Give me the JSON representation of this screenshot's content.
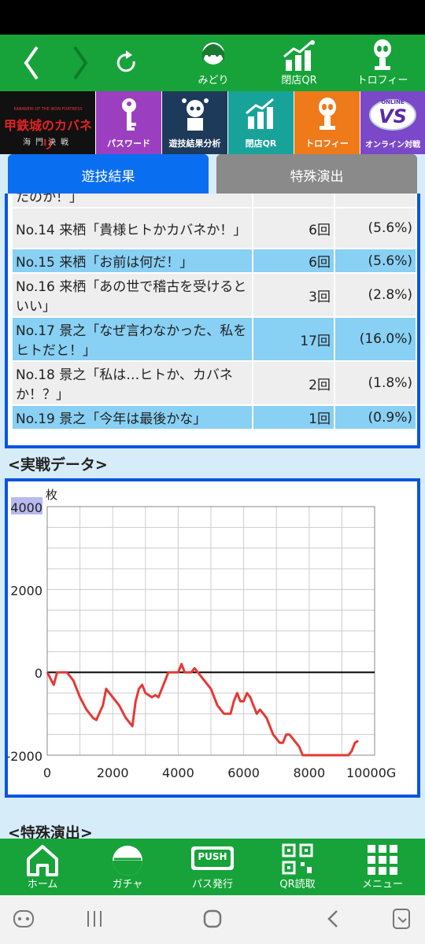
{
  "top_nav": {
    "back": "back",
    "forward": "forward",
    "refresh": "refresh",
    "items": [
      {
        "label": "みどり",
        "icon": "character-icon"
      },
      {
        "label": "閉店QR",
        "icon": "qr-chart-icon"
      },
      {
        "label": "トロフィー",
        "icon": "trophy-icon"
      }
    ]
  },
  "banners": {
    "logo_title": "甲鉄城のカバネリ",
    "logo_sub_top": "KABANERI OF THE IRON FORTRESS",
    "logo_sub": "海門決戦",
    "items": [
      {
        "label": "パスワード",
        "color": "#9b3fc0",
        "icon": "key-icon"
      },
      {
        "label": "遊技結果分析",
        "color": "#1e3a5a",
        "icon": "analysis-icon"
      },
      {
        "label": "閉店QR",
        "color": "#17a39a",
        "icon": "qr-chart-icon"
      },
      {
        "label": "トロフィー",
        "color": "#ee7a1a",
        "icon": "trophy-icon"
      },
      {
        "label": "オンライン対戦",
        "color": "#7a48c8",
        "icon": "versus-icon",
        "badge_top": "ONLINE",
        "badge_main": "VS"
      }
    ]
  },
  "tabs": [
    {
      "label": "遊技結果",
      "active": true
    },
    {
      "label": "特殊演出",
      "active": false
    }
  ],
  "results": {
    "partial_top": "たのか！」",
    "rows": [
      {
        "name": "No.14 来栖「貴様ヒトかカバネか！」",
        "count": "6回",
        "pct": "(5.6%)",
        "style": "grey"
      },
      {
        "name": "No.15 来栖「お前は何だ！」",
        "count": "6回",
        "pct": "(5.6%)",
        "style": "blue"
      },
      {
        "name": "No.16 来栖「あの世で稽古を受けるといい」",
        "count": "3回",
        "pct": "(2.8%)",
        "style": "grey"
      },
      {
        "name": "No.17 景之「なぜ言わなかった、私をヒトだと！」",
        "count": "17回",
        "pct": "(16.0%)",
        "style": "blue"
      },
      {
        "name": "No.18 景之「私は…ヒトか、カバネか！？」",
        "count": "2回",
        "pct": "(1.8%)",
        "style": "grey"
      },
      {
        "name": "No.19 景之「今年は最後かな」",
        "count": "1回",
        "pct": "(0.9%)",
        "style": "blue"
      }
    ]
  },
  "section_battle": "<実戦データ>",
  "section_special": "<特殊演出>",
  "chart_data": {
    "type": "line",
    "ylabel": "枚",
    "xlabel": "",
    "ylim": [
      -2000,
      4000
    ],
    "xlim": [
      0,
      10000
    ],
    "y_ticks": [
      "4000",
      "2000",
      "0",
      "-2000"
    ],
    "y_tick_values": [
      4000,
      2000,
      0,
      -2000
    ],
    "x_ticks": [
      "0",
      "2000",
      "4000",
      "6000",
      "8000",
      "10000G"
    ],
    "x_tick_values": [
      0,
      2000,
      4000,
      6000,
      8000,
      10000
    ],
    "grid": true,
    "line_color": "#e53935",
    "series": [
      {
        "x": [
          0,
          200,
          300,
          600,
          800,
          1000,
          1200,
          1400,
          1500,
          1700,
          1800,
          2000,
          2200,
          2400,
          2600,
          2700,
          2800,
          2900,
          3000,
          3200,
          3300,
          3400,
          3500,
          3600,
          3700,
          3800,
          4000,
          4100,
          4200,
          4300,
          4400,
          4500,
          4600,
          4700,
          4800,
          5000,
          5200,
          5400,
          5600,
          5700,
          5800,
          5900,
          6000,
          6100,
          6200,
          6300,
          6400,
          6500,
          6600,
          6700,
          6800,
          6900,
          7000,
          7100,
          7200,
          7300,
          7400,
          7500,
          7600,
          7700,
          7800,
          7900,
          8000,
          8200,
          8400,
          8600,
          8800,
          9000,
          9200,
          9300,
          9400,
          9500
        ],
        "y": [
          0,
          -300,
          0,
          0,
          -200,
          -600,
          -900,
          -1100,
          -1150,
          -800,
          -400,
          -600,
          -800,
          -1100,
          -1300,
          -700,
          -400,
          -300,
          -500,
          -600,
          -550,
          -600,
          -400,
          -200,
          0,
          0,
          0,
          200,
          0,
          0,
          0,
          100,
          0,
          -100,
          -200,
          -400,
          -800,
          -1000,
          -1000,
          -700,
          -500,
          -700,
          -700,
          -500,
          -600,
          -800,
          -1000,
          -900,
          -1000,
          -1100,
          -1300,
          -1500,
          -1600,
          -1700,
          -1700,
          -1500,
          -1500,
          -1600,
          -1700,
          -1800,
          -2000,
          -2000,
          -2000,
          -2000,
          -2000,
          -2000,
          -2000,
          -2000,
          -2000,
          -1900,
          -1700,
          -1650
        ]
      }
    ]
  },
  "bottom_nav": [
    {
      "label": "ホーム",
      "icon": "home-icon"
    },
    {
      "label": "ガチャ",
      "icon": "gacha-icon"
    },
    {
      "label": "パス発行",
      "icon": "push-icon",
      "badge": "PUSH"
    },
    {
      "label": "QR読取",
      "icon": "qr-icon"
    },
    {
      "label": "メニュー",
      "icon": "menu-grid-icon"
    }
  ],
  "system_bar": [
    "game-launcher-icon",
    "recents-icon",
    "home-circle-icon",
    "back-chevron-icon",
    "screenshot-icon"
  ]
}
